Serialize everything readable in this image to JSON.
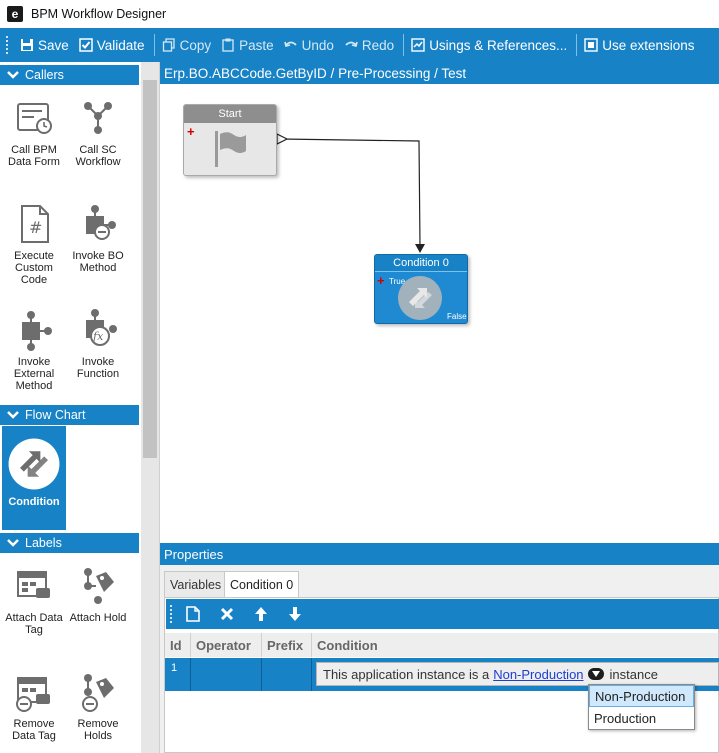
{
  "window": {
    "title": "BPM Workflow Designer",
    "app_icon_letter": "e"
  },
  "toolbar": {
    "save": "Save",
    "validate": "Validate",
    "copy": "Copy",
    "paste": "Paste",
    "undo": "Undo",
    "redo": "Redo",
    "usings": "Usings & References...",
    "extensions": "Use extensions"
  },
  "toolbox": {
    "callers": {
      "title": "Callers",
      "items": [
        {
          "label": "Call BPM Data Form",
          "icon": "data-form-icon"
        },
        {
          "label": "Call SC Workflow",
          "icon": "workflow-icon"
        },
        {
          "label": "Execute Custom Code",
          "icon": "code-file-icon"
        },
        {
          "label": "Invoke BO Method",
          "icon": "bo-method-icon"
        },
        {
          "label": "Invoke External Method",
          "icon": "external-method-icon"
        },
        {
          "label": "Invoke Function",
          "icon": "function-icon"
        }
      ]
    },
    "flowchart": {
      "title": "Flow Chart",
      "items": [
        {
          "label": "Condition",
          "icon": "condition-icon"
        }
      ]
    },
    "labels": {
      "title": "Labels",
      "items": [
        {
          "label": "Attach Data Tag",
          "icon": "data-tag-icon"
        },
        {
          "label": "Attach Hold",
          "icon": "hold-icon"
        },
        {
          "label": "Remove Data Tag",
          "icon": "remove-data-tag-icon"
        },
        {
          "label": "Remove Holds",
          "icon": "remove-hold-icon"
        }
      ]
    }
  },
  "canvas": {
    "breadcrumb": "Erp.BO.ABCCode.GetByID / Pre-Processing / Test",
    "start_node": {
      "title": "Start"
    },
    "condition_node": {
      "title": "Condition 0",
      "true_label": "True",
      "false_label": "False"
    }
  },
  "properties": {
    "title": "Properties",
    "tabs": [
      "Variables",
      "Condition 0"
    ],
    "columns": [
      "Id",
      "Operator",
      "Prefix",
      "Condition"
    ],
    "row": {
      "id": "1",
      "operator": "",
      "prefix": "",
      "condition_prefix": "This application instance is a",
      "condition_value": "Non-Production",
      "condition_suffix": "instance"
    },
    "dropdown_options": [
      "Non-Production",
      "Production"
    ],
    "dropdown_selected": "Non-Production"
  }
}
